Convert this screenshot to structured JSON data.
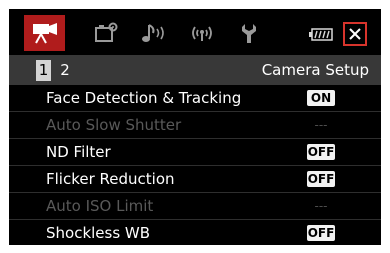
{
  "tabs": [
    {
      "icon": "movie-camera-icon",
      "active": true
    },
    {
      "icon": "camera-settings-icon",
      "active": false
    },
    {
      "icon": "audio-icon",
      "active": false
    },
    {
      "icon": "wireless-icon",
      "active": false
    },
    {
      "icon": "wrench-icon",
      "active": false
    }
  ],
  "status": {
    "battery_icon": "battery-icon",
    "close_icon": "close-icon",
    "close_color": "#d8342c"
  },
  "pager": {
    "pages": [
      "1",
      "2"
    ],
    "current": "1",
    "title": "Camera Setup"
  },
  "menu": {
    "items": [
      {
        "label": "Face Detection & Tracking",
        "value": "ON",
        "enabled": true
      },
      {
        "label": "Auto Slow Shutter",
        "value": "---",
        "enabled": false
      },
      {
        "label": "ND Filter",
        "value": "OFF",
        "enabled": true
      },
      {
        "label": "Flicker Reduction",
        "value": "OFF",
        "enabled": true
      },
      {
        "label": "Auto ISO Limit",
        "value": "---",
        "enabled": false
      },
      {
        "label": "Shockless WB",
        "value": "OFF",
        "enabled": true
      }
    ]
  },
  "colors": {
    "active_tab": "#b01c1c",
    "background": "#000000",
    "pager_bar": "#383838",
    "disabled_text": "#595959",
    "icon_gray": "#9a9a9a"
  }
}
